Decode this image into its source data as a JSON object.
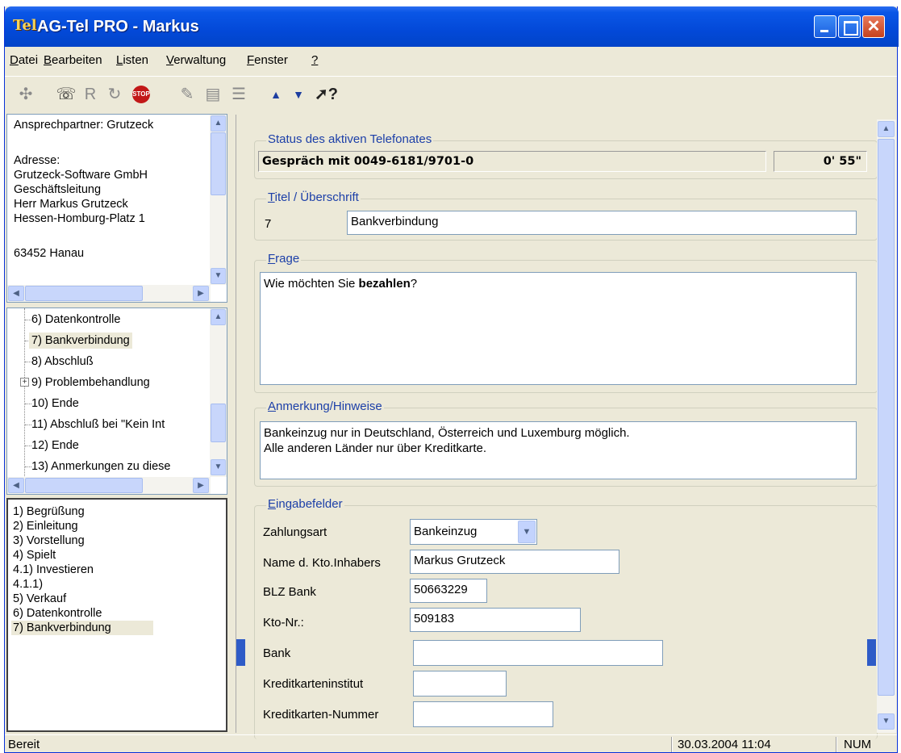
{
  "window": {
    "logo": "Tel",
    "title": "AG-Tel PRO - Markus",
    "close_glyph": "✕"
  },
  "menu": [
    {
      "key": "D",
      "rest": "atei"
    },
    {
      "key": "B",
      "rest": "earbeiten"
    },
    {
      "key": "L",
      "rest": "isten"
    },
    {
      "key": "V",
      "rest": "erwaltung"
    },
    {
      "key": "F",
      "rest": "enster"
    },
    {
      "key": "?",
      "rest": ""
    }
  ],
  "toolbar": {
    "icons": [
      "connect-icon",
      "dial-icon",
      "redial-icon",
      "refresh-icon",
      "stop-icon",
      "note-icon",
      "print-icon",
      "list-icon",
      "arrow-up-icon",
      "arrow-down-icon",
      "help-cursor-icon"
    ],
    "redial_letter": "R",
    "stop_label": "STOP",
    "help_label": "?"
  },
  "contact": {
    "lines": [
      "Ansprechpartner: Grutzeck",
      "",
      "Adresse:",
      "Grutzeck-Software GmbH",
      "Geschäftsleitung",
      "Herr Markus Grutzeck",
      "Hessen-Homburg-Platz 1",
      "",
      "63452 Hanau"
    ]
  },
  "tree": {
    "items": [
      {
        "label": "6) Datenkontrolle"
      },
      {
        "label": "7) Bankverbindung"
      },
      {
        "label": "8) Abschluß"
      },
      {
        "label": "9) Problembehandlung"
      },
      {
        "label": "10) Ende"
      },
      {
        "label": "11) Abschluß bei \"Kein Int"
      },
      {
        "label": "12) Ende"
      },
      {
        "label": "13) Anmerkungen zu diese"
      }
    ],
    "selected_index": 1,
    "expandable_index": 3,
    "expander_glyph": "+"
  },
  "history": {
    "items": [
      "1) Begrüßung",
      "2) Einleitung",
      "3) Vorstellung",
      "4) Spielt",
      "4.1) Investieren",
      "4.1.1)",
      "5) Verkauf",
      "6) Datenkontrolle",
      "7) Bankverbindung"
    ],
    "selected_index": 8
  },
  "status_group": {
    "legend": "Status des aktiven Telefonates",
    "call_text": "Gespräch mit 0049-6181/9701-0",
    "duration": "0' 55\""
  },
  "title_group": {
    "legend_key": "T",
    "legend_rest": "itel / Überschrift",
    "number": "7",
    "value": "Bankverbindung"
  },
  "question_group": {
    "legend_key": "F",
    "legend_rest": "rage",
    "text_before": "Wie möchten Sie ",
    "text_bold": "bezahlen",
    "text_after": "?"
  },
  "notes_group": {
    "legend_key": "A",
    "legend_rest": "nmerkung/Hinweise",
    "lines": [
      "Bankeinzug nur in Deutschland, Österreich und Luxemburg möglich.",
      "Alle anderen Länder nur über Kreditkarte."
    ]
  },
  "input_group": {
    "legend_key": "E",
    "legend_rest": "ingabefelder",
    "fields": [
      {
        "label": "Zahlungsart",
        "value": "Bankeinzug"
      },
      {
        "label": "Name d. Kto.Inhabers",
        "value": "Markus Grutzeck"
      },
      {
        "label": "BLZ Bank",
        "value": "50663229"
      },
      {
        "label": "Kto-Nr.:",
        "value": "509183"
      },
      {
        "label": "Bank",
        "value": ""
      },
      {
        "label": "Kreditkarteninstitut",
        "value": ""
      },
      {
        "label": "Kreditkarten-Nummer",
        "value": ""
      }
    ]
  },
  "statusbar": {
    "text": "Bereit",
    "datetime": "30.03.2004  11:04",
    "num": "NUM"
  },
  "colors": {
    "titlebar": "#0349d8",
    "legend": "#1c3fa8",
    "face": "#ece9d8"
  }
}
